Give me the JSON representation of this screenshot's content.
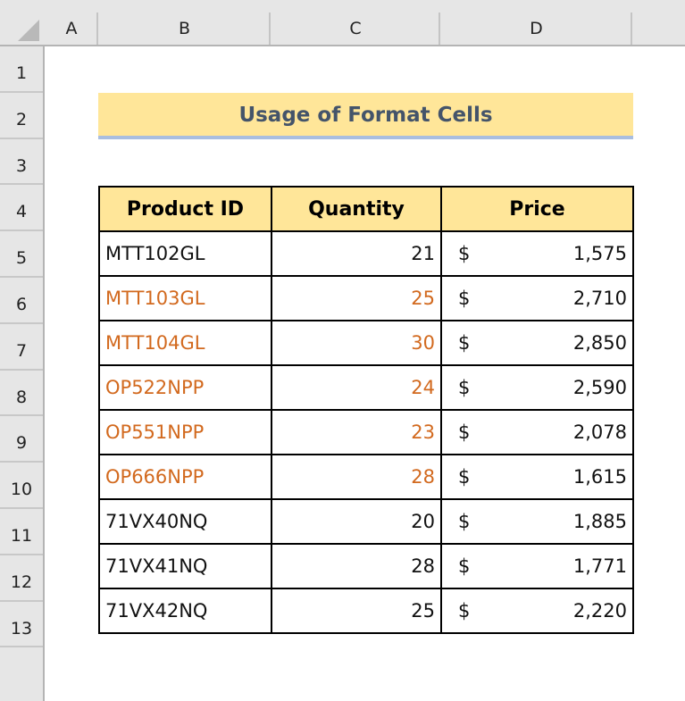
{
  "column_headers": [
    "A",
    "B",
    "C",
    "D"
  ],
  "row_headers": [
    "1",
    "2",
    "3",
    "4",
    "5",
    "6",
    "7",
    "8",
    "9",
    "10",
    "11",
    "12",
    "13"
  ],
  "title": "Usage of Format Cells",
  "colors": {
    "title_fill": "#ffe699",
    "title_text": "#44546a",
    "highlight_text": "#d2691e",
    "normal_text": "#111111"
  },
  "table": {
    "headers": [
      "Product ID",
      "Quantity",
      "Price"
    ],
    "currency_symbol": "$",
    "rows": [
      {
        "product_id": "MTT102GL",
        "quantity": "21",
        "price": "1,575",
        "highlighted": false
      },
      {
        "product_id": "MTT103GL",
        "quantity": "25",
        "price": "2,710",
        "highlighted": true
      },
      {
        "product_id": "MTT104GL",
        "quantity": "30",
        "price": "2,850",
        "highlighted": true
      },
      {
        "product_id": "OP522NPP",
        "quantity": "24",
        "price": "2,590",
        "highlighted": true
      },
      {
        "product_id": "OP551NPP",
        "quantity": "23",
        "price": "2,078",
        "highlighted": true
      },
      {
        "product_id": "OP666NPP",
        "quantity": "28",
        "price": "1,615",
        "highlighted": true
      },
      {
        "product_id": "71VX40NQ",
        "quantity": "20",
        "price": "1,885",
        "highlighted": false
      },
      {
        "product_id": "71VX41NQ",
        "quantity": "28",
        "price": "1,771",
        "highlighted": false
      },
      {
        "product_id": "71VX42NQ",
        "quantity": "25",
        "price": "2,220",
        "highlighted": false
      }
    ]
  }
}
